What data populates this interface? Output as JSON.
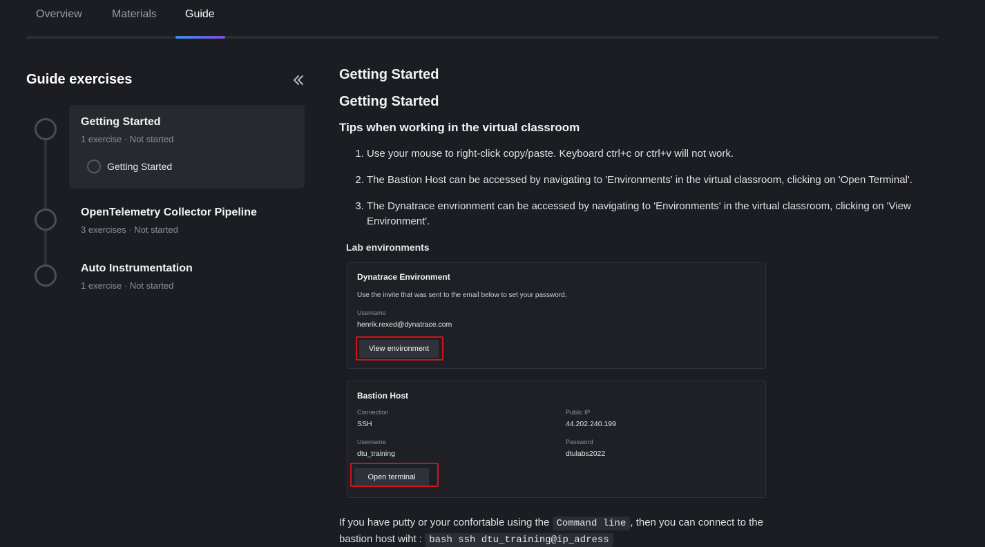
{
  "tabs": [
    {
      "label": "Overview"
    },
    {
      "label": "Materials"
    },
    {
      "label": "Guide",
      "active": true
    }
  ],
  "sidebar": {
    "title": "Guide exercises",
    "collapse_icon": "double-chevron-left-icon",
    "steps": [
      {
        "title": "Getting Started",
        "subtitle": "1 exercise · Not started",
        "items": [
          {
            "label": "Getting Started"
          }
        ]
      },
      {
        "title": "OpenTelemetry Collector Pipeline",
        "subtitle": "3 exercises · Not started"
      },
      {
        "title": "Auto Instrumentation",
        "subtitle": "1 exercise · Not started"
      }
    ]
  },
  "main": {
    "heading1": "Getting Started",
    "heading2": "Getting Started",
    "tips_heading": "Tips when working in the virtual classroom",
    "tips": [
      "Use your mouse to right-click copy/paste. Keyboard ctrl+c or ctrl+v will not work.",
      "The Bastion Host can be accessed by navigating to 'Environments' in the virtual classroom, clicking on 'Open Terminal'.",
      "The Dynatrace envrionment can be accessed by navigating to 'Environments' in the virtual classroom, clicking on 'View Environment'."
    ],
    "lab": {
      "title": "Lab environments",
      "dynatrace": {
        "title": "Dynatrace Environment",
        "description": "Use the invite that was sent to the email below to set your password.",
        "username_label": "Username",
        "username": "henrik.rexed@dynatrace.com",
        "button": "View environment"
      },
      "bastion": {
        "title": "Bastion Host",
        "connection_label": "Connection",
        "connection": "SSH",
        "public_ip_label": "Public IP",
        "public_ip": "44.202.240.199",
        "username_label": "Username",
        "username": "dtu_training",
        "password_label": "Password",
        "password": "dtulabs2022",
        "button": "Open terminal"
      }
    },
    "para1_pre": "If you have putty or your confortable using the ",
    "para1_code": "Command line",
    "para1_post": ", then you can connect to the",
    "para2_pre": "bastion host wiht : ",
    "para2_code": "bash ssh dtu_training@ip_adress"
  },
  "colors": {
    "background": "#1b1d22",
    "highlight_red": "#d1141c",
    "tab_indicator_start": "#3e8ee8",
    "tab_indicator_end": "#7c4bd8"
  }
}
